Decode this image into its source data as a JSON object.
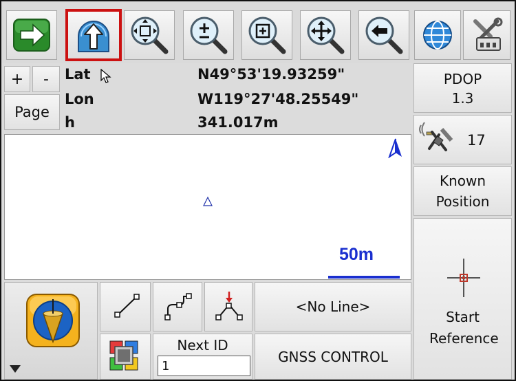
{
  "toolbar": {
    "buttons": [
      {
        "name": "forward-button",
        "icon": "green-arrow-right-icon"
      },
      {
        "name": "north-up-button",
        "icon": "north-up-globe-icon",
        "selected": true
      },
      {
        "name": "zoom-extents-button",
        "icon": "zoom-extents-icon"
      },
      {
        "name": "zoom-in-out-button",
        "icon": "zoom-in-out-icon"
      },
      {
        "name": "zoom-window-button",
        "icon": "zoom-window-icon"
      },
      {
        "name": "pan-button",
        "icon": "pan-icon"
      },
      {
        "name": "zoom-previous-button",
        "icon": "zoom-previous-icon"
      },
      {
        "name": "globe-button",
        "icon": "globe-icon"
      },
      {
        "name": "settings-button",
        "icon": "tools-icon"
      }
    ],
    "selected_color": "#cc1111"
  },
  "position_panel": {
    "plus_label": "+",
    "minus_label": "-",
    "page_label": "Page",
    "lat_label": "Lat",
    "lat_value": "N49°53'19.93259\"",
    "lon_label": "Lon",
    "lon_value": "W119°27'48.25549\"",
    "h_label": "h",
    "h_value": "341.017m"
  },
  "right_panel": {
    "pdop_label": "PDOP",
    "pdop_value": "1.3",
    "satellites_count": "17",
    "known_position_label": "Known Position",
    "start_reference_label": "Start Reference"
  },
  "map": {
    "scale_label": "50m",
    "scale_color": "#1a2fcf"
  },
  "bottom": {
    "line_label": "<No Line>",
    "next_id_label": "Next ID",
    "next_id_value": "1",
    "gnss_label": "GNSS CONTROL"
  }
}
